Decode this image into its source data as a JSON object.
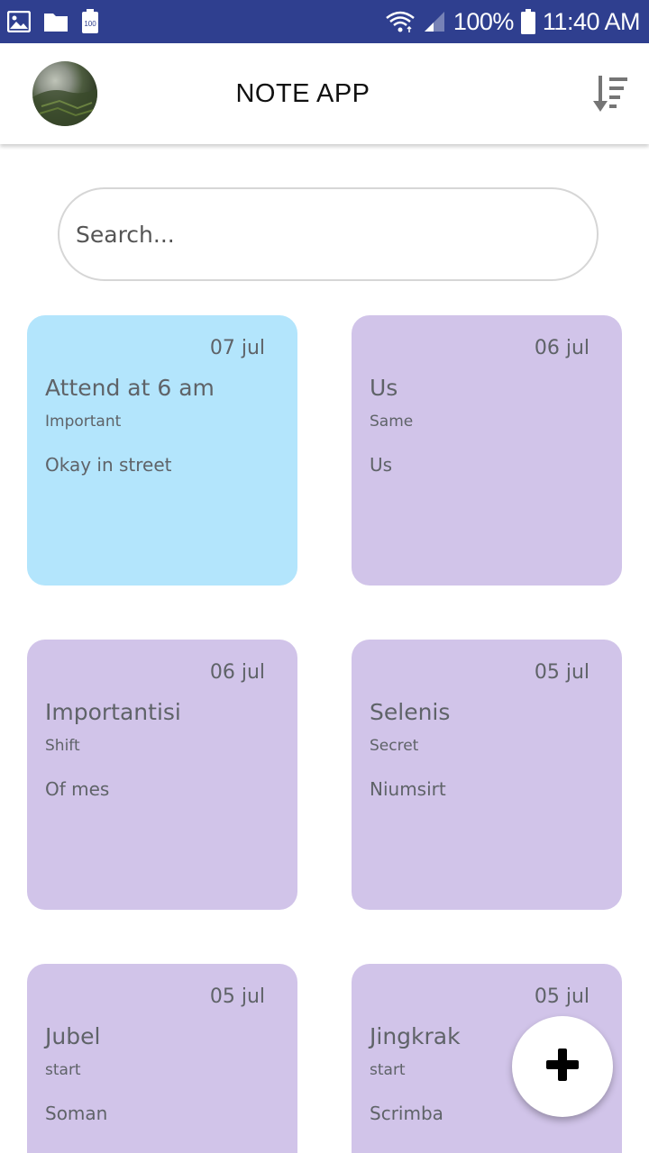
{
  "status_bar": {
    "battery": "100%",
    "time": "11:40 AM",
    "left_icons": [
      "image-icon",
      "folder-icon",
      "battery-saver-icon"
    ],
    "right_icons": [
      "wifi-icon",
      "signal-icon",
      "battery-icon"
    ],
    "battery_saver_label": "100"
  },
  "app_bar": {
    "title": "NOTE APP",
    "avatar_icon": "avatar",
    "sort_icon": "sort-icon"
  },
  "search": {
    "placeholder": "Search...",
    "value": ""
  },
  "notes": [
    {
      "date": "07 jul",
      "title": "Attend at 6 am",
      "subtitle": "Important",
      "body": "Okay in street",
      "color": "#b3e5fc"
    },
    {
      "date": "06 jul",
      "title": "Us",
      "subtitle": "Same",
      "body": "Us",
      "color": "#d1c4e9"
    },
    {
      "date": "06 jul",
      "title": "Importantisi",
      "subtitle": "Shift",
      "body": "Of mes",
      "color": "#d1c4e9"
    },
    {
      "date": "05 jul",
      "title": "Selenis",
      "subtitle": "Secret",
      "body": "Niumsirt",
      "color": "#d1c4e9"
    },
    {
      "date": "05 jul",
      "title": "Jubel",
      "subtitle": "start",
      "body": "Soman",
      "color": "#d1c4e9"
    },
    {
      "date": "05 jul",
      "title": "Jingkrak",
      "subtitle": "start",
      "body": "Scrimba",
      "color": "#d1c4e9"
    }
  ],
  "fab": {
    "icon": "plus-icon"
  },
  "colors": {
    "status_bar": "#2f3f8f",
    "card_blue": "#b3e5fc",
    "card_purple": "#d1c4e9",
    "text_gray": "#5f6368"
  }
}
